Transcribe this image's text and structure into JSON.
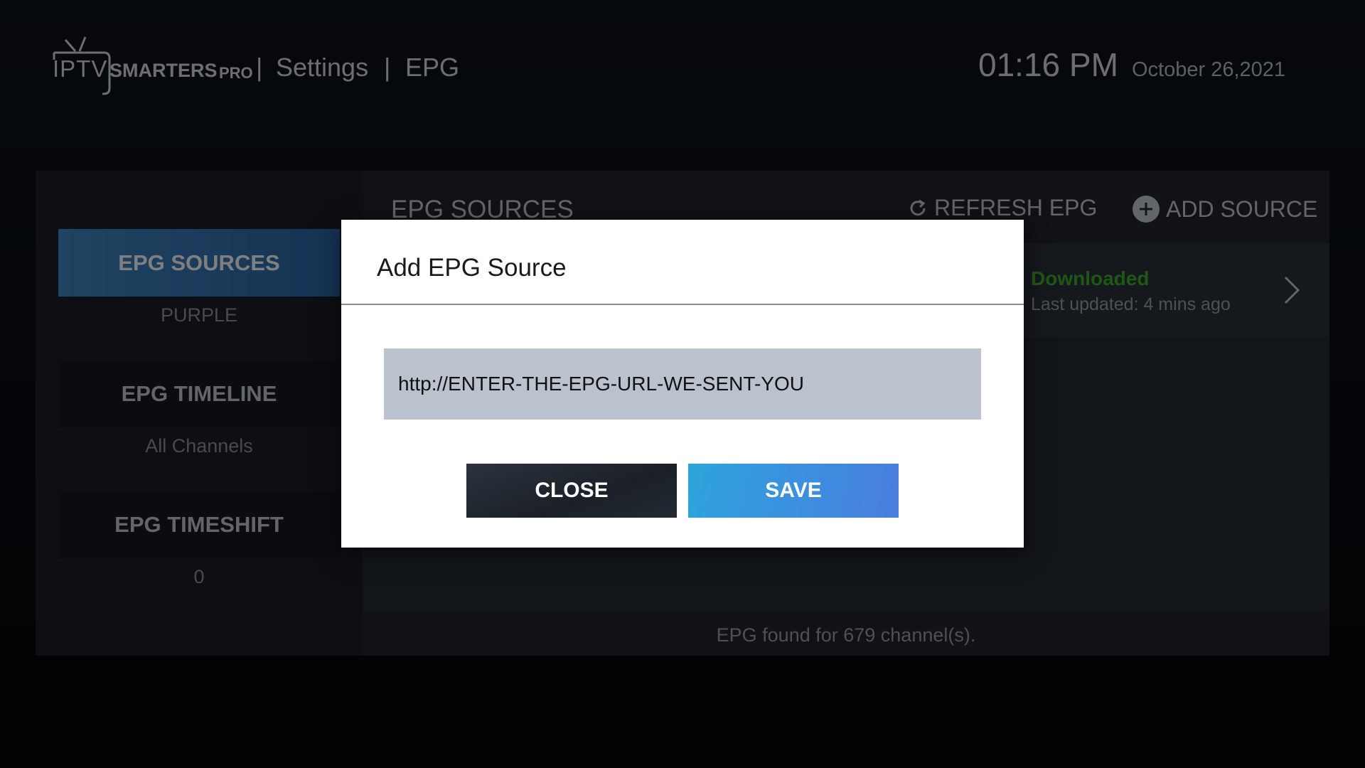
{
  "header": {
    "logo_iptv": "IPTV",
    "logo_smarters": "SMARTERS",
    "logo_pro": "PRO",
    "separator": "|",
    "crumb_settings": "Settings",
    "crumb_epg": "EPG",
    "time": "01:16 PM",
    "date": "October 26,2021"
  },
  "sidebar": {
    "items": [
      {
        "label": "EPG SOURCES",
        "value": "PURPLE"
      },
      {
        "label": "EPG TIMELINE",
        "value": "All Channels"
      },
      {
        "label": "EPG TIMESHIFT",
        "value": "0"
      }
    ]
  },
  "content": {
    "title": "EPG SOURCES",
    "refresh_label": "REFRESH EPG",
    "add_label": "ADD SOURCE",
    "source": {
      "status": "Downloaded",
      "updated": "Last updated: 4 mins ago"
    },
    "footer": "EPG found for 679 channel(s)."
  },
  "dialog": {
    "title": "Add EPG Source",
    "url_value": "http://ENTER-THE-EPG-URL-WE-SENT-YOU",
    "close_label": "CLOSE",
    "save_label": "SAVE"
  },
  "colors": {
    "accent_blue": "#3c8fdf",
    "status_green": "#3fae2a",
    "panel": "#1d2229"
  }
}
